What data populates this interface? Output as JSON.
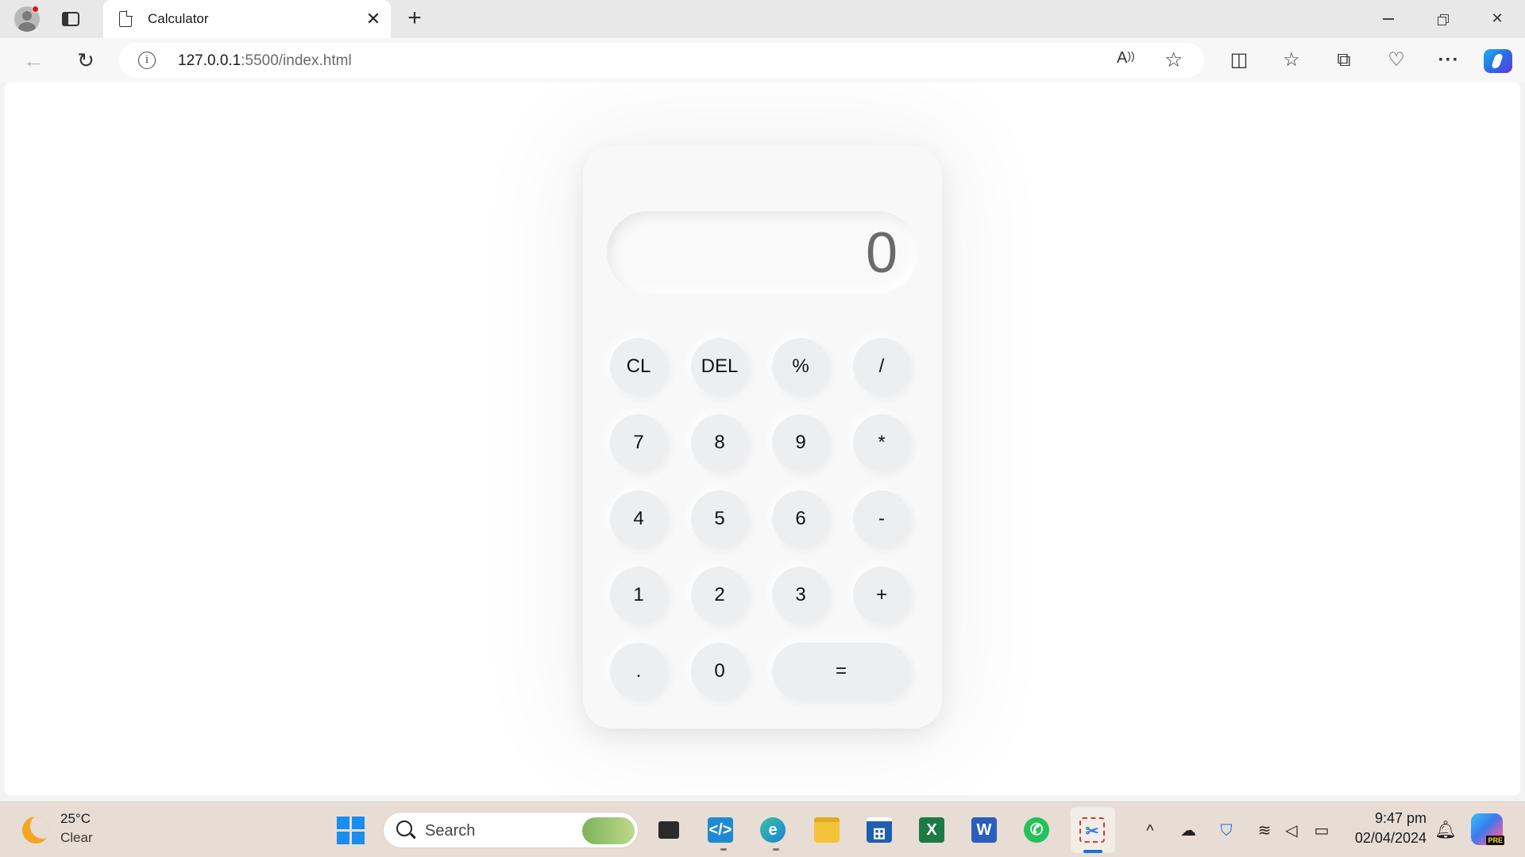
{
  "browser": {
    "tab_title": "Calculator",
    "tab_close": "✕",
    "new_tab": "+",
    "url_host": "127.0.0.1",
    "url_path": ":5500/index.html",
    "info_icon": "i",
    "read_aloud": "Aʒ",
    "more": "···"
  },
  "calculator": {
    "display_value": "0",
    "keys": [
      {
        "label": "CL",
        "name": "clear"
      },
      {
        "label": "DEL",
        "name": "delete"
      },
      {
        "label": "%",
        "name": "percent"
      },
      {
        "label": "/",
        "name": "divide"
      },
      {
        "label": "7",
        "name": "seven"
      },
      {
        "label": "8",
        "name": "eight"
      },
      {
        "label": "9",
        "name": "nine"
      },
      {
        "label": "*",
        "name": "multiply"
      },
      {
        "label": "4",
        "name": "four"
      },
      {
        "label": "5",
        "name": "five"
      },
      {
        "label": "6",
        "name": "six"
      },
      {
        "label": "-",
        "name": "subtract"
      },
      {
        "label": "1",
        "name": "one"
      },
      {
        "label": "2",
        "name": "two"
      },
      {
        "label": "3",
        "name": "three"
      },
      {
        "label": "+",
        "name": "add"
      },
      {
        "label": ".",
        "name": "decimal"
      },
      {
        "label": "0",
        "name": "zero"
      },
      {
        "label": "=",
        "name": "equals"
      }
    ]
  },
  "taskbar": {
    "weather_temp": "25°C",
    "weather_desc": "Clear",
    "search_placeholder": "Search",
    "time": "9:47 pm",
    "date": "02/04/2024",
    "copilot_badge": "PRE"
  },
  "colors": {
    "tabbar_bg": "#e8e8e8",
    "taskbar_bg": "#e7ddd4",
    "calculator_bg": "#f8f8f8",
    "key_bg": "#eceef0",
    "display_text": "#6a6a6a",
    "accent": "#1a8ef0"
  }
}
